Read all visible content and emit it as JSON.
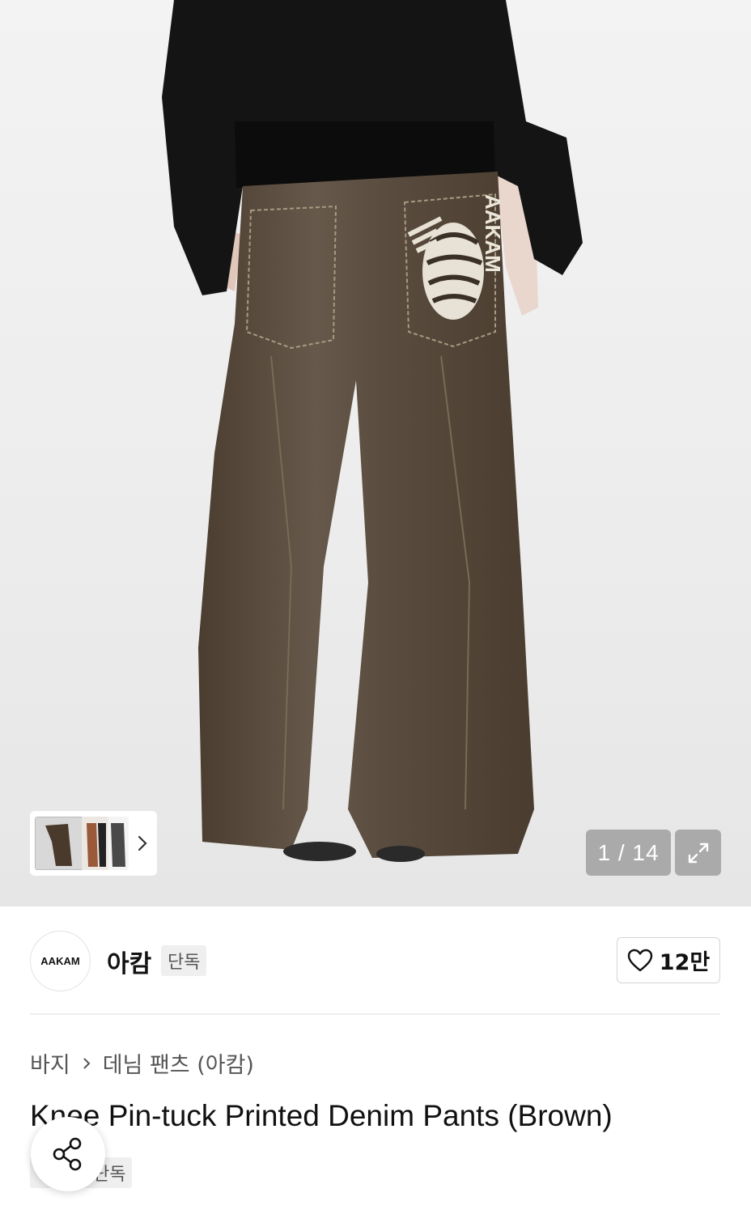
{
  "gallery": {
    "counter": "1 / 14",
    "print_text": "AAKAM"
  },
  "brand": {
    "logo_text": "AAKAM",
    "name": "아캄",
    "badge": "단독",
    "likes": "12만"
  },
  "breadcrumb": {
    "items": [
      "바지",
      "데님 팬츠 (아캄)"
    ]
  },
  "product": {
    "title": "Knee Pin-tuck Printed Denim Pants (Brown)",
    "badge": "단독"
  },
  "icons": {
    "thumb_next": "chevron-right-icon",
    "expand": "expand-icon",
    "like": "heart-icon",
    "share": "share-icon"
  },
  "colors": {
    "pants": "#5a4a3a",
    "jacket": "#141414",
    "counter_bg": "#969696"
  }
}
